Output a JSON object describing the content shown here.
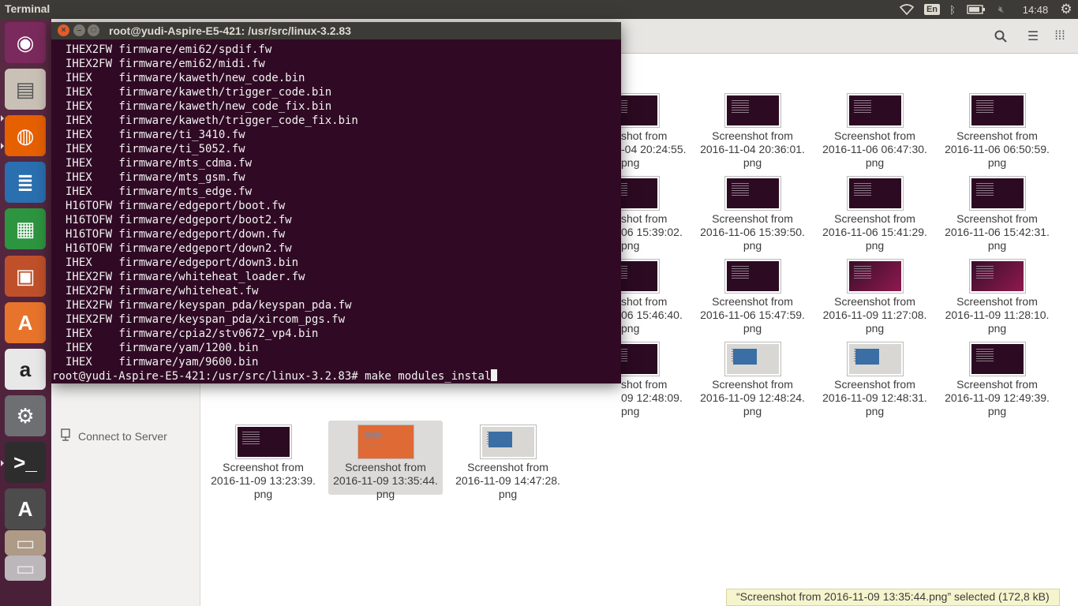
{
  "top_panel": {
    "app_title": "Terminal",
    "keyboard_layout": "En",
    "clock": "14:48"
  },
  "launcher": {
    "items": [
      {
        "name": "ubuntu-dash",
        "glyph": "◉",
        "bg": "#7a2a5c"
      },
      {
        "name": "files",
        "glyph": "▤",
        "bg": "#c9c1b6"
      },
      {
        "name": "firefox",
        "glyph": "◍",
        "bg": "#e66000"
      },
      {
        "name": "libreoffice-writer",
        "glyph": "≣",
        "bg": "#2a6fb0"
      },
      {
        "name": "libreoffice-calc",
        "glyph": "▦",
        "bg": "#2d9440"
      },
      {
        "name": "libreoffice-impress",
        "glyph": "▣",
        "bg": "#c0502a"
      },
      {
        "name": "software-center",
        "glyph": "A",
        "bg": "#e8742c"
      },
      {
        "name": "amazon",
        "glyph": "a",
        "bg": "#e8e8e8"
      },
      {
        "name": "system-settings",
        "glyph": "⚙",
        "bg": "#6d6f73"
      },
      {
        "name": "terminal",
        "glyph": ">_",
        "bg": "#2d2d2d"
      },
      {
        "name": "software-updater",
        "glyph": "A",
        "bg": "#4c4c4c"
      },
      {
        "name": "image-viewer",
        "glyph": "▭",
        "bg": "#b8a890"
      },
      {
        "name": "trash",
        "glyph": "▭",
        "bg": "#c8c8c8"
      }
    ]
  },
  "nautilus": {
    "connect_server_label": "Connect to Server",
    "files": [
      {
        "name": "Screenshot from\n2016-11-04 20:36:01.\npng",
        "style": "dark"
      },
      {
        "name": "Screenshot from\n2016-11-06 06:47:30.\npng",
        "style": "dark"
      },
      {
        "name": "Screenshot from\n2016-11-06 06:50:59.\npng",
        "style": "dark"
      },
      {
        "name": "Screenshot from\n2016-11-06 15:39:50.\npng",
        "style": "dark"
      },
      {
        "name": "Screenshot from\n2016-11-06 15:41:29.\npng",
        "style": "dark"
      },
      {
        "name": "Screenshot from\n2016-11-06 15:42:31.\npng",
        "style": "dark"
      },
      {
        "name": "Screenshot from\n2016-11-06 15:47:59.\npng",
        "style": "dark"
      },
      {
        "name": "Screenshot from\n2016-11-09 11:27:08.\npng",
        "style": "purple"
      },
      {
        "name": "Screenshot from\n2016-11-09 11:28:10.\npng",
        "style": "purple"
      },
      {
        "name": "Screenshot from\n2016-11-09 12:48:24.\npng",
        "style": "light"
      },
      {
        "name": "Screenshot from\n2016-11-09 12:48:31.\npng",
        "style": "light"
      },
      {
        "name": "Screenshot from\n2016-11-09 12:49:39.\npng",
        "style": "dark"
      },
      {
        "name": "Screenshot from\n2016-11-09 13:23:39.\npng",
        "style": "dark"
      },
      {
        "name": "Screenshot from\n2016-11-09 13:35:44.\npng",
        "style": "orange"
      },
      {
        "name": "Screenshot from\n2016-11-09 14:47:28.\npng",
        "style": "light"
      }
    ],
    "clipped_files": [
      "shot from\n-04 20:24:55.\npng",
      "shot from\n06 15:39:02.\npng",
      "shot from\n06 15:46:40.\npng",
      "shot from\n09 12:48:09.\npng"
    ],
    "status": "“Screenshot from 2016-11-09 13:35:44.png” selected  (172,8 kB)"
  },
  "terminal": {
    "title": "root@yudi-Aspire-E5-421: /usr/src/linux-3.2.83",
    "lines": [
      "IHEX2FW firmware/emi62/spdif.fw",
      "IHEX2FW firmware/emi62/midi.fw",
      "IHEX    firmware/kaweth/new_code.bin",
      "IHEX    firmware/kaweth/trigger_code.bin",
      "IHEX    firmware/kaweth/new_code_fix.bin",
      "IHEX    firmware/kaweth/trigger_code_fix.bin",
      "IHEX    firmware/ti_3410.fw",
      "IHEX    firmware/ti_5052.fw",
      "IHEX    firmware/mts_cdma.fw",
      "IHEX    firmware/mts_gsm.fw",
      "IHEX    firmware/mts_edge.fw",
      "H16TOFW firmware/edgeport/boot.fw",
      "H16TOFW firmware/edgeport/boot2.fw",
      "H16TOFW firmware/edgeport/down.fw",
      "H16TOFW firmware/edgeport/down2.fw",
      "IHEX    firmware/edgeport/down3.bin",
      "IHEX2FW firmware/whiteheat_loader.fw",
      "IHEX2FW firmware/whiteheat.fw",
      "IHEX2FW firmware/keyspan_pda/keyspan_pda.fw",
      "IHEX2FW firmware/keyspan_pda/xircom_pgs.fw",
      "IHEX    firmware/cpia2/stv0672_vp4.bin",
      "IHEX    firmware/yam/1200.bin",
      "IHEX    firmware/yam/9600.bin"
    ],
    "prompt": "root@yudi-Aspire-E5-421:/usr/src/linux-3.2.83# make modules_instal"
  }
}
